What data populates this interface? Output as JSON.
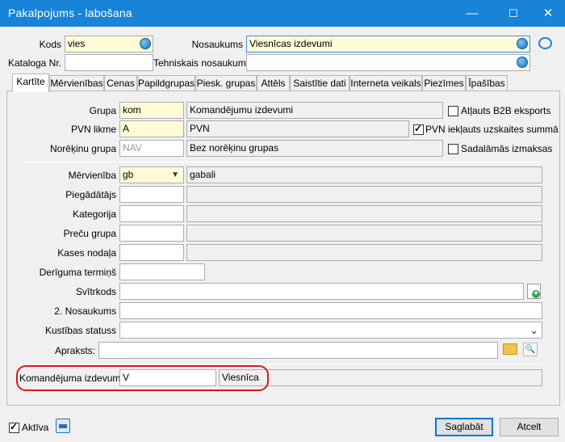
{
  "window": {
    "title": "Pakalpojums - labošana",
    "min": "—",
    "max": "☐",
    "close": "✕"
  },
  "header": {
    "kods_label": "Kods",
    "kods_value": "vies",
    "nosaukums_label": "Nosaukums",
    "nosaukums_value": "Viesnīcas izdevumi",
    "kataloga_label": "Kataloga Nr.",
    "kataloga_value": "",
    "tehniskais_label": "Tehniskais nosaukums",
    "tehniskais_value": ""
  },
  "tabs": [
    {
      "label": "Kartīte"
    },
    {
      "label": "Mērvienības"
    },
    {
      "label": "Cenas"
    },
    {
      "label": "Papildgrupas"
    },
    {
      "label": "Piesk. grupas"
    },
    {
      "label": "Attēls"
    },
    {
      "label": "Saistītie dati"
    },
    {
      "label": "Interneta veikals"
    },
    {
      "label": "Piezīmes"
    },
    {
      "label": "Īpašības"
    }
  ],
  "form": {
    "grupa_label": "Grupa",
    "grupa_code": "kom",
    "grupa_name": "Komandējumu izdevumi",
    "b2b_label": "Atļauts B2B eksports",
    "b2b_checked": false,
    "pvn_label": "PVN likme",
    "pvn_code": "A",
    "pvn_name": "PVN",
    "pvn_incl_label": "PVN iekļauts uzskaites summā",
    "pvn_incl_checked": true,
    "norekinu_label": "Norēķinu grupa",
    "norekinu_code": "NAV",
    "norekinu_name": "Bez norēķinu grupas",
    "sadalamas_label": "Sadalāmās izmaksas",
    "sadalamas_checked": false,
    "mervieniba_label": "Mērvienība",
    "mervieniba_code": "gb",
    "mervieniba_name": "gabali",
    "piegadatajs_label": "Piegādātājs",
    "kategorija_label": "Kategorija",
    "precu_grupa_label": "Preču grupa",
    "kases_label": "Kases nodaļa",
    "deriguma_label": "Derīguma termiņš",
    "svitrkods_label": "Svītrkods",
    "nosaukums2_label": "2. Nosaukums",
    "kustibas_label": "Kustības statuss",
    "apraksts_label": "Apraksts:",
    "komandejuma_label": "Komandējuma izdevums",
    "komandejuma_code": "V",
    "komandejuma_name": "Viesnīca"
  },
  "footer": {
    "aktiva_label": "Aktīva",
    "aktiva_checked": true,
    "save_label": "Saglabāt",
    "cancel_label": "Atcelt"
  },
  "colors": {
    "titlebar": "#1883d7",
    "required_bg": "#fffbd6",
    "highlight": "#d21d23"
  }
}
